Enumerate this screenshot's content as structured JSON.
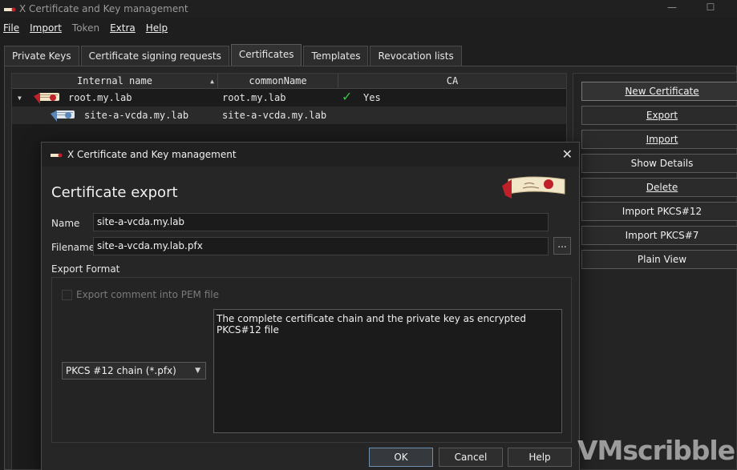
{
  "window": {
    "title": "X Certificate and Key management",
    "minimize": "—",
    "maximize": "☐"
  },
  "menu": [
    {
      "label": "File",
      "enabled": true
    },
    {
      "label": "Import",
      "enabled": true
    },
    {
      "label": "Token",
      "enabled": false
    },
    {
      "label": "Extra",
      "enabled": true
    },
    {
      "label": "Help",
      "enabled": true
    }
  ],
  "tabs": [
    "Private Keys",
    "Certificate signing requests",
    "Certificates",
    "Templates",
    "Revocation lists"
  ],
  "active_tab": "Certificates",
  "table": {
    "columns": [
      "Internal name",
      "commonName",
      "CA"
    ],
    "rows": [
      {
        "internal_name": "root.my.lab",
        "common_name": "root.my.lab",
        "ca": "Yes"
      },
      {
        "internal_name": "site-a-vcda.my.lab",
        "common_name": "site-a-vcda.my.lab",
        "ca": ""
      }
    ]
  },
  "side_buttons": [
    "New Certificate",
    "Export",
    "Import",
    "Show Details",
    "Delete",
    "Import PKCS#12",
    "Import PKCS#7",
    "Plain View"
  ],
  "dialog": {
    "title": "X Certificate and Key management",
    "heading": "Certificate export",
    "name_label": "Name",
    "name_value": "site-a-vcda.my.lab",
    "filename_label": "Filename",
    "filename_value": "site-a-vcda.my.lab.pfx",
    "browse_label": "...",
    "export_format_label": "Export Format",
    "export_comment_label": "Export comment into PEM file",
    "format_selected": "PKCS #12 chain (*.pfx)",
    "description": "The complete certificate chain and the private key as encrypted PKCS#12 file",
    "ok": "OK",
    "cancel": "Cancel",
    "help": "Help"
  },
  "watermark": "VMscribble",
  "colors": {
    "accent_check": "#2ecc40",
    "scroll_red": "#c0202a",
    "scroll_paper": "#f2e6c8",
    "scroll_blue": "#5b86b8"
  }
}
